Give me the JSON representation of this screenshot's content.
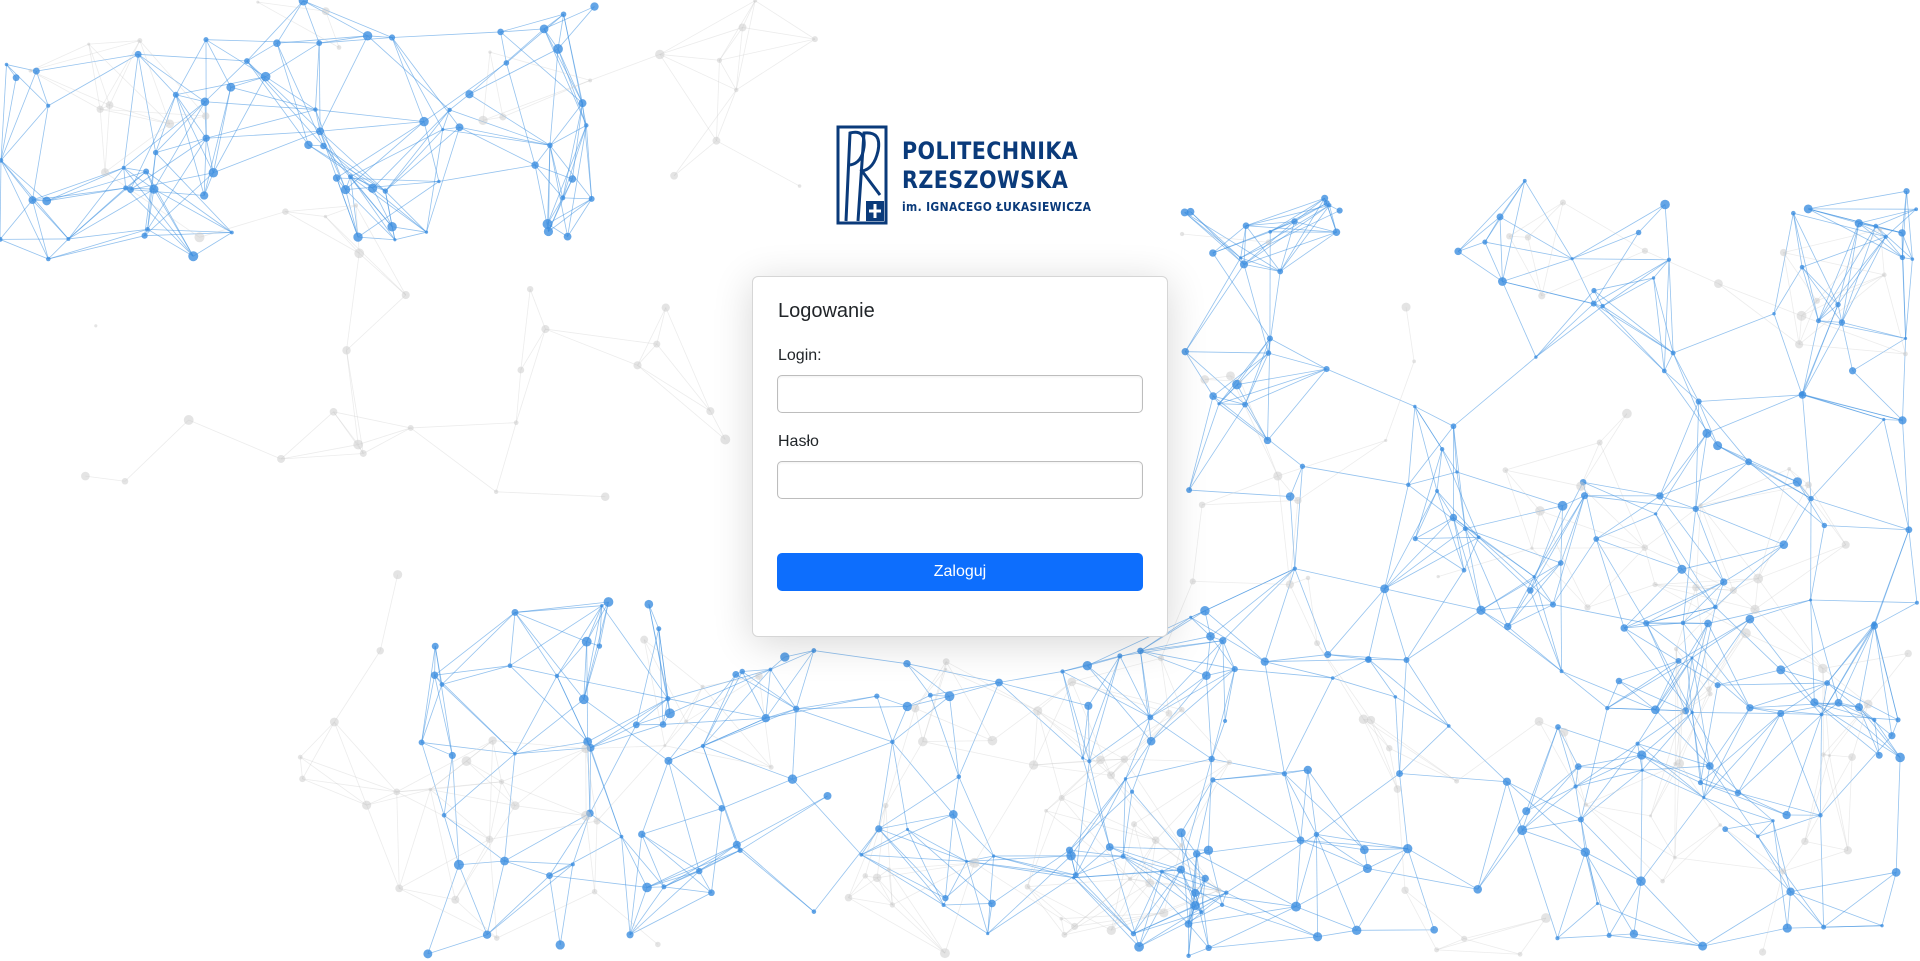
{
  "logo": {
    "line1": "POLITECHNIKA",
    "line2": "RZESZOWSKA",
    "line3": "im. IGNACEGO ŁUKASIEWICZA",
    "color": "#0a3a7a"
  },
  "login_form": {
    "title": "Logowanie",
    "login_label": "Login:",
    "login_value": "",
    "password_label": "Hasło",
    "password_value": "",
    "submit_label": "Zaloguj"
  },
  "colors": {
    "accent": "#0d6efd",
    "network_blue": "#3d8fe0",
    "network_gray": "#c9c9c9"
  }
}
